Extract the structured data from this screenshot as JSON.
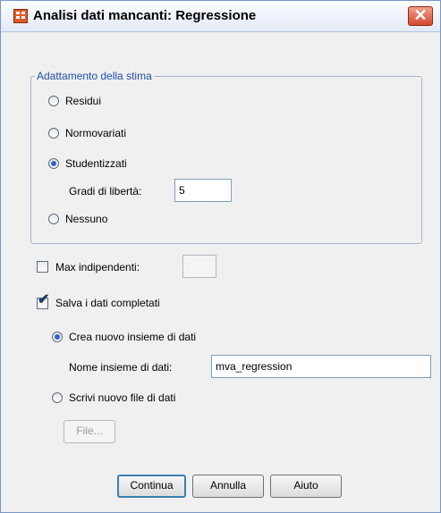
{
  "window": {
    "title": "Analisi dati mancanti: Regressione",
    "close_glyph": "✕",
    "icon": "spss-app-icon"
  },
  "adjustment_group": {
    "legend": "Adattamento della stima",
    "options": [
      {
        "label": "Residui",
        "checked": false
      },
      {
        "label": "Normovariati",
        "checked": false
      },
      {
        "label": "Studentizzati",
        "checked": true
      },
      {
        "label": "Nessuno",
        "checked": false
      }
    ],
    "df_label": "Gradi di libertà:",
    "df_value": "5"
  },
  "max_indep": {
    "label": "Max indipendenti:",
    "checked": false,
    "value": ""
  },
  "save": {
    "label": "Salva i dati completati",
    "checked": true,
    "new_dataset_label": "Crea nuovo insieme di dati",
    "new_dataset_checked": true,
    "dataset_name_label": "Nome insieme di dati:",
    "dataset_name_value": "mva_regression",
    "new_file_label": "Scrivi nuovo file di dati",
    "new_file_checked": false,
    "file_button": "File..."
  },
  "buttons": {
    "continue": "Continua",
    "cancel": "Annulla",
    "help": "Aiuto"
  },
  "colors": {
    "accent": "#2a66c8",
    "group_legend": "#1f4ea8",
    "close": "#d24a2e"
  }
}
